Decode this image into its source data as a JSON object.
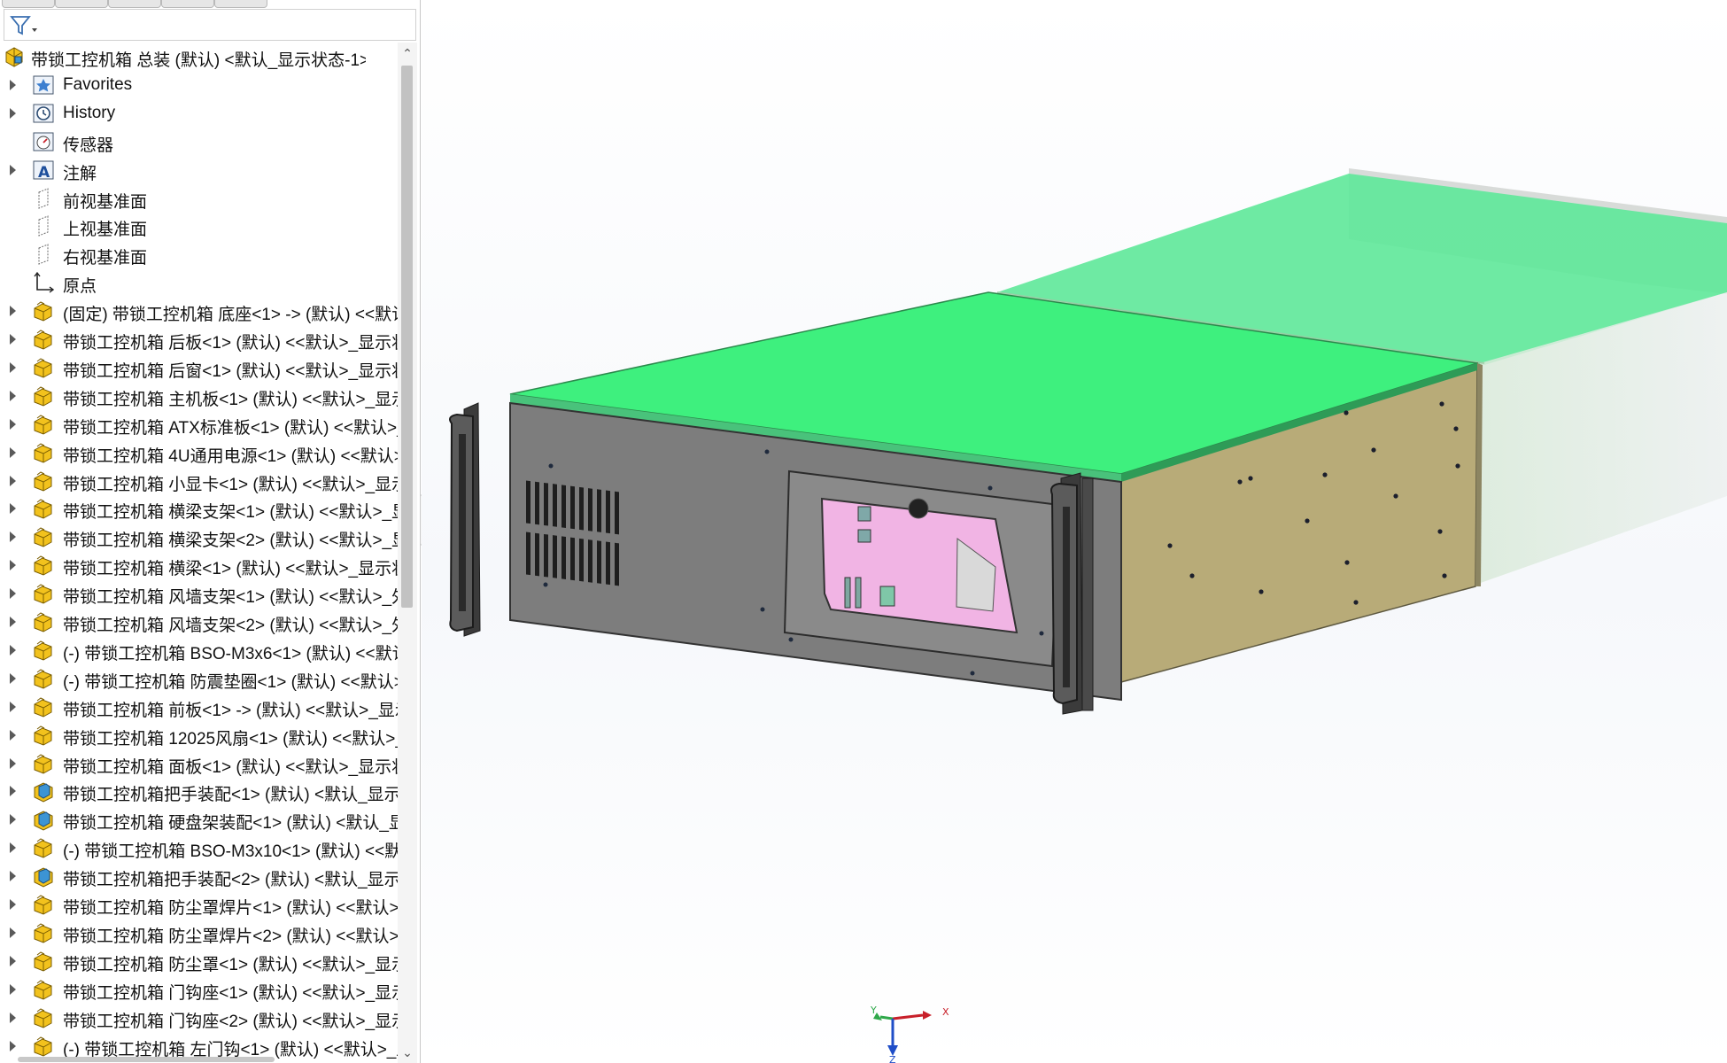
{
  "colors": {
    "lid": "#3ef07e",
    "side_panel": "#b8ab78",
    "front_panel": "#7d7d7d",
    "window_glass": "#f1b4e4",
    "part_icon": "#f2c21d",
    "subassembly_icon": "#3c94d4"
  },
  "tree": {
    "filter_icon": "filter-icon",
    "root": {
      "label": "带锁工控机箱 总装 (默认) <默认_显示状态-1>",
      "icon": "assembly-icon"
    },
    "items": [
      {
        "label": "Favorites",
        "icon": "favorites-icon",
        "expander": true
      },
      {
        "label": "History",
        "icon": "history-icon",
        "expander": true
      },
      {
        "label": "传感器",
        "icon": "sensor-icon",
        "expander": false
      },
      {
        "label": "注解",
        "icon": "annotation-icon",
        "expander": true
      },
      {
        "label": "前视基准面",
        "icon": "plane-icon",
        "expander": false
      },
      {
        "label": "上视基准面",
        "icon": "plane-icon",
        "expander": false
      },
      {
        "label": "右视基准面",
        "icon": "plane-icon",
        "expander": false
      },
      {
        "label": "原点",
        "icon": "origin-icon",
        "expander": false
      },
      {
        "label": "(固定) 带锁工控机箱 底座<1> -> (默认) <<默认",
        "icon": "part-icon",
        "expander": true
      },
      {
        "label": "带锁工控机箱 后板<1> (默认) <<默认>_显示状",
        "icon": "part-icon",
        "expander": true
      },
      {
        "label": "带锁工控机箱 后窗<1> (默认) <<默认>_显示状",
        "icon": "part-icon",
        "expander": true
      },
      {
        "label": "带锁工控机箱 主机板<1> (默认) <<默认>_显示",
        "icon": "part-icon",
        "expander": true
      },
      {
        "label": "带锁工控机箱 ATX标准板<1> (默认) <<默认>_",
        "icon": "part-icon",
        "expander": true
      },
      {
        "label": "带锁工控机箱 4U通用电源<1> (默认) <<默认>",
        "icon": "part-icon",
        "expander": true
      },
      {
        "label": "带锁工控机箱 小显卡<1> (默认) <<默认>_显示",
        "icon": "part-icon",
        "expander": true
      },
      {
        "label": "带锁工控机箱 横梁支架<1> (默认) <<默认>_显",
        "icon": "part-icon",
        "expander": true
      },
      {
        "label": "带锁工控机箱 横梁支架<2> (默认) <<默认>_显",
        "icon": "part-icon",
        "expander": true
      },
      {
        "label": "带锁工控机箱 横梁<1> (默认) <<默认>_显示状",
        "icon": "part-icon",
        "expander": true
      },
      {
        "label": "带锁工控机箱 风墙支架<1> (默认) <<默认>_外",
        "icon": "part-icon",
        "expander": true
      },
      {
        "label": "带锁工控机箱 风墙支架<2> (默认) <<默认>_外",
        "icon": "part-icon",
        "expander": true
      },
      {
        "label": "(-) 带锁工控机箱 BSO-M3x6<1> (默认) <<默认",
        "icon": "part-icon",
        "expander": true
      },
      {
        "label": "(-) 带锁工控机箱 防震垫圈<1> (默认) <<默认>",
        "icon": "part-icon",
        "expander": true
      },
      {
        "label": "带锁工控机箱 前板<1> -> (默认) <<默认>_显示",
        "icon": "part-icon",
        "expander": true
      },
      {
        "label": "带锁工控机箱 12025风扇<1> (默认) <<默认>_",
        "icon": "part-icon",
        "expander": true
      },
      {
        "label": "带锁工控机箱 面板<1> (默认) <<默认>_显示状",
        "icon": "part-icon",
        "expander": true
      },
      {
        "label": "带锁工控机箱把手装配<1> (默认) <默认_显示状",
        "icon": "subassembly-icon",
        "expander": true
      },
      {
        "label": "带锁工控机箱  硬盘架装配<1> (默认) <默认_显",
        "icon": "subassembly-icon",
        "expander": true
      },
      {
        "label": "(-) 带锁工控机箱 BSO-M3x10<1> (默认) <<默",
        "icon": "part-icon",
        "expander": true
      },
      {
        "label": "带锁工控机箱把手装配<2> (默认) <默认_显示状",
        "icon": "subassembly-icon",
        "expander": true
      },
      {
        "label": "带锁工控机箱 防尘罩焊片<1> (默认) <<默认>_",
        "icon": "part-icon",
        "expander": true
      },
      {
        "label": "带锁工控机箱 防尘罩焊片<2> (默认) <<默认>_",
        "icon": "part-icon",
        "expander": true
      },
      {
        "label": "带锁工控机箱 防尘罩<1> (默认) <<默认>_显示",
        "icon": "part-icon",
        "expander": true
      },
      {
        "label": "带锁工控机箱 门钩座<1> (默认) <<默认>_显示",
        "icon": "part-icon",
        "expander": true
      },
      {
        "label": "带锁工控机箱 门钩座<2> (默认) <<默认>_显示",
        "icon": "part-icon",
        "expander": true
      },
      {
        "label": "(-) 带锁工控机箱 左门钩<1> (默认) <<默认>_显",
        "icon": "part-icon",
        "expander": true
      }
    ]
  },
  "triad": {
    "x_label": "X",
    "y_label": "Y",
    "z_label": "Z"
  }
}
